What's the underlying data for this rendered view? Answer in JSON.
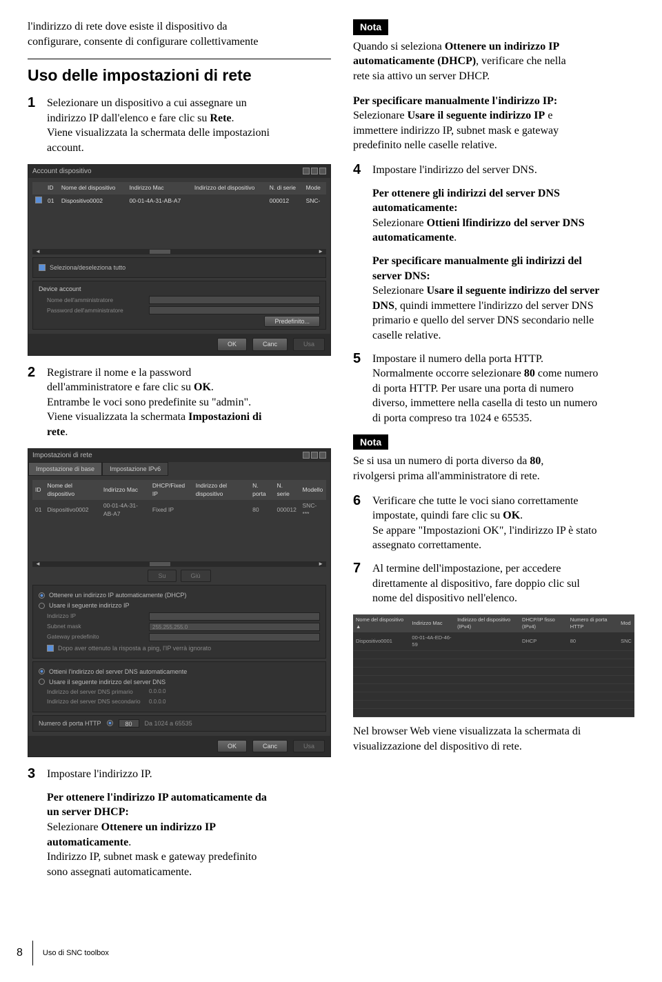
{
  "intro_line1": "l'indirizzo di rete dove esiste il dispositivo da",
  "intro_line2": "configurare, consente di configurare collettivamente",
  "section_title": "Uso delle impostazioni di rete",
  "step1": {
    "l1": "Selezionare un dispositivo a cui assegnare un",
    "l2": "indirizzo IP dall'elenco e fare clic su ",
    "l2b": "Rete",
    "l2c": ".",
    "l3": "Viene visualizzata la schermata delle impostazioni",
    "l4": "account."
  },
  "ss1": {
    "title": "Account dispositivo",
    "cols": {
      "c1": "ID",
      "c2": "Nome del dispositivo",
      "c3": "Indirizzo Mac",
      "c4": "Indirizzo del dispositivo",
      "c5": "N. di serie",
      "c6": "Mode"
    },
    "row": {
      "chk": "✓",
      "id": "01",
      "name": "Dispositivo0002",
      "mac": "00-01-4A-31-AB-A7",
      "addr": "",
      "serial": "000012",
      "mode": "SNC-"
    },
    "sel_all": "Seleziona/deseleziona tutto",
    "device_account": "Device account",
    "admin_name": "Nome dell'amministratore",
    "admin_pass": "Password dell'amministratore",
    "predef": "Predefinito...",
    "ok": "OK",
    "canc": "Canc",
    "usa": "Usa"
  },
  "step2": {
    "l1": "Registrare il nome e la password",
    "l2a": "dell'amministratore e fare clic su ",
    "l2b": "OK",
    "l2c": ".",
    "l3": "Entrambe le voci sono predefinite su \"admin\".",
    "l4a": "Viene visualizzata la schermata ",
    "l4b": "Impostazioni di",
    "l5": "rete",
    "l5c": "."
  },
  "ss2": {
    "title": "Impostazioni di rete",
    "tab1": "Impostazione di base",
    "tab2": "Impostazione IPv6",
    "cols": {
      "c1": "ID",
      "c2": "Nome del dispositivo",
      "c3": "Indirizzo Mac",
      "c4": "DHCP/Fixed IP",
      "c5": "Indirizzo del dispositivo",
      "c6": "N. porta",
      "c7": "N. serie",
      "c8": "Modello"
    },
    "row": {
      "id": "01",
      "name": "Dispositivo0002",
      "mac": "00-01-4A-31-AB-A7",
      "dhcp": "Fixed IP",
      "addr": "",
      "port": "80",
      "serial": "000012",
      "model": "SNC-***"
    },
    "btn_su": "Su",
    "btn_giu": "Giù",
    "opt_dhcp": "Ottenere un indirizzo IP automaticamente (DHCP)",
    "opt_fixed": "Usare il seguente indirizzo IP",
    "f_ip": "Indirizzo IP",
    "f_mask": "Subnet mask",
    "f_mask_val": "255.255.255.0",
    "f_gw": "Gateway predefinito",
    "note_ping": "Dopo aver ottenuto la risposta a ping, l'IP verrà ignorato",
    "opt_dns_auto": "Ottieni l'indirizzo del server DNS automaticamente",
    "opt_dns_man": "Usare il seguente indirizzo del server DNS",
    "f_dns1": "Indirizzo del server DNS primario",
    "f_dns1_val": "0.0.0.0",
    "f_dns2": "Indirizzo del server DNS secondario",
    "f_dns2_val": "0.0.0.0",
    "f_http": "Numero di porta HTTP",
    "f_http_val": "80",
    "f_http_range": "Da 1024 a 65535",
    "ok": "OK",
    "canc": "Canc",
    "usa": "Usa"
  },
  "step3": {
    "head": "Impostare l'indirizzo IP.",
    "p1l1b": "Per ottenere l'indirizzo IP automaticamente da",
    "p1l2b": "un server DHCP:",
    "p1l3a": "Selezionare ",
    "p1l3b": "Ottenere un indirizzo IP",
    "p1l4b": "automaticamente",
    "p1l4c": ".",
    "p1l5": "Indirizzo IP, subnet mask e gateway predefinito",
    "p1l6": "sono assegnati automaticamente."
  },
  "nota": "Nota",
  "nota1": {
    "l1a": "Quando si seleziona ",
    "l1b": "Ottenere un indirizzo IP",
    "l2b": "automaticamente (DHCP)",
    "l2c": ", verificare che nella",
    "l3": "rete sia attivo un server DHCP."
  },
  "manual_ip": {
    "h": "Per specificare manualmente l'indirizzo IP:",
    "l1a": "Selezionare ",
    "l1b": "Usare il seguente indirizzo IP",
    "l1c": " e",
    "l2": "immettere indirizzo IP, subnet mask e gateway",
    "l3": "predefinito nelle caselle relative."
  },
  "step4": {
    "head": "Impostare l'indirizzo del server DNS.",
    "ah1": "Per ottenere gli indirizzi del server DNS",
    "ah2": "automaticamente:",
    "al1a": "Selezionare ",
    "al1b": "Ottieni lfindirizzo del server DNS",
    "al2b": "automaticamente",
    "al2c": ".",
    "bh1": "Per specificare manualmente gli indirizzi del",
    "bh2": "server DNS:",
    "bl1a": "Selezionare ",
    "bl1b": "Usare il seguente indirizzo del server",
    "bl2b": "DNS",
    "bl2c": ", quindi immettere l'indirizzo del server DNS",
    "bl3": "primario e quello del server DNS secondario nelle",
    "bl4": "caselle relative."
  },
  "step5": {
    "l1": "Impostare il numero della porta HTTP.",
    "l2a": "Normalmente occorre selezionare ",
    "l2b": "80",
    "l2c": " come numero",
    "l3": "di porta HTTP. Per usare una porta di numero",
    "l4": "diverso, immettere nella casella di testo un numero",
    "l5": "di porta compreso tra 1024 e 65535."
  },
  "nota2": {
    "l1a": "Se si usa un numero di porta diverso da ",
    "l1b": "80",
    "l1c": ",",
    "l2": "rivolgersi prima all'amministratore di rete."
  },
  "step6": {
    "l1": "Verificare che tutte le voci siano correttamente",
    "l2a": "impostate, quindi fare clic su ",
    "l2b": "OK",
    "l2c": ".",
    "l3": "Se appare \"Impostazioni OK\", l'indirizzo IP è stato",
    "l4": "assegnato correttamente."
  },
  "step7": {
    "l1": "Al termine dell'impostazione, per accedere",
    "l2": "direttamente al dispositivo, fare doppio clic sul",
    "l3": "nome del dispositivo nell'elenco."
  },
  "ss3": {
    "cols": {
      "c1": "Nome del dispositivo",
      "c1b": "▲",
      "c2": "Indirizzo Mac",
      "c3": "Indirizzo del dispositivo (IPv4)",
      "c4": "DHCP/IP fisso (IPv4)",
      "c5": "Numero di porta HTTP",
      "c6": "Mod"
    },
    "row": {
      "name": "Dispositivo0001",
      "mac": "00-01-4A-ED-46-59",
      "addr": "",
      "dhcp": "DHCP",
      "port": "80",
      "mod": "SNC"
    }
  },
  "closing": {
    "l1": "Nel browser Web viene visualizzata la schermata di",
    "l2": "visualizzazione del dispositivo di rete."
  },
  "footer": {
    "num": "8",
    "text": "Uso di SNC toolbox"
  }
}
